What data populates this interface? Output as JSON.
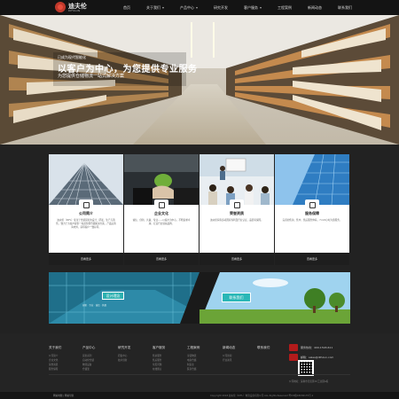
{
  "header": {
    "logo_name": "迪夫伦",
    "logo_sub": "DIFULUN",
    "nav": [
      "首页",
      "关于我们",
      "产品中心",
      "研究开发",
      "客户服务",
      "工程案例",
      "新闻动态",
      "联系我们"
    ],
    "nav_has_dropdown": [
      false,
      true,
      true,
      false,
      true,
      false,
      false,
      false
    ]
  },
  "hero": {
    "line1": "已成为现代智能化",
    "line2": "以客户为中心，为您提供专业服务",
    "line3": "为您提供仓储物流一站式解决方案"
  },
  "features": [
    {
      "title": "公司简介",
      "body": "迪夫伦（DIFL）专注于仓储货架的设计、研发、生产与销售，致力于为客户提供一站式智能仓储解决方案，产品远销海内外，获得客户一致好评。",
      "more": "查看更多"
    },
    {
      "title": "企业文化",
      "body": "诚信、创新、共赢、专业——以客户为中心，不断追求卓越，打造行业领先品牌。",
      "more": "查看更多"
    },
    {
      "title": "荣誉资质",
      "body": "迪夫伦获得多项国家专利及行业认证，品质有保障。",
      "more": "查看更多"
    },
    {
      "title": "服务保障",
      "body": "完善的售前、售中、售后服务体系，7×24小时为您服务。",
      "more": "查看更多"
    }
  ],
  "banners": {
    "left_button": "设计理念",
    "left_caption": "创新 · 专业 · 诚信 · 共赢",
    "right_button": "联系我们"
  },
  "footer": {
    "columns": [
      {
        "heading": "关于我们",
        "links": [
          "公司简介",
          "企业文化",
          "荣誉资质",
          "服务保障"
        ]
      },
      {
        "heading": "产品中心",
        "links": [
          "货架系列",
          "自动化仓储",
          "物流设备",
          "仓储笼"
        ]
      },
      {
        "heading": "研究开发",
        "links": [
          "研发中心",
          "技术创新"
        ]
      },
      {
        "heading": "客户服务",
        "links": [
          "售前服务",
          "售后服务",
          "常见问题",
          "在线留言"
        ]
      },
      {
        "heading": "工程案例",
        "links": [
          "冷链物流",
          "电商仓储",
          "制造业",
          "医药仓储"
        ]
      },
      {
        "heading": "新闻动态",
        "links": [
          "公司新闻",
          "行业资讯"
        ]
      }
    ],
    "contact_title": "联系我们",
    "phone": "服务热线：400-1518-611",
    "email": "邮箱：sales@difulun.com",
    "address": "公司地址：深圳市宝安区XX工业园A栋",
    "bottom_links": "网站地图 | 网站导航",
    "copyright": "Copyright 2018 迪夫伦（DIFL）物流设备有限公司 ALL Rights Reserved 粤ICP备18036175号-1"
  }
}
